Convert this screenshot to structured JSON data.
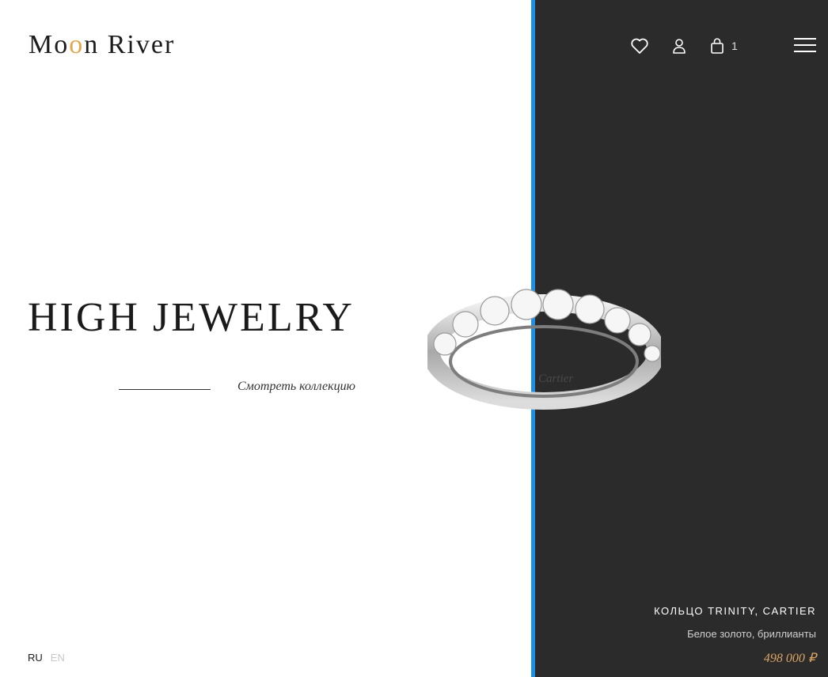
{
  "brand": {
    "logo_part1": "Mo",
    "logo_gold": "o",
    "logo_part2": "n River"
  },
  "header": {
    "cart_count": "1"
  },
  "hero": {
    "title": "HIGH JEWELRY",
    "cta_label": "Смотреть коллекцию"
  },
  "product": {
    "name": "КОЛЬЦО TRINITY, CARTIER",
    "description": "Белое золото, бриллианты",
    "price": "498 000 ₽",
    "engraving": "Cartier"
  },
  "languages": [
    {
      "label": "RU",
      "active": true
    },
    {
      "label": "EN",
      "active": false
    }
  ],
  "colors": {
    "dark_panel": "#2b2b2b",
    "divider": "#1e8fe6",
    "gold": "#e0a84a",
    "price": "#d9a565"
  },
  "icons": [
    "heart-icon",
    "user-icon",
    "cart-icon",
    "menu-icon"
  ]
}
